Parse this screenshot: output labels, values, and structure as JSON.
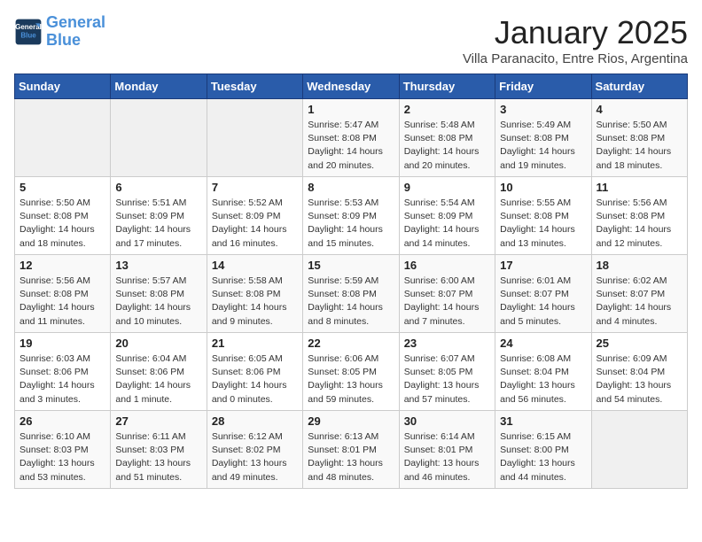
{
  "logo": {
    "line1": "General",
    "line2": "Blue"
  },
  "title": "January 2025",
  "subtitle": "Villa Paranacito, Entre Rios, Argentina",
  "days_of_week": [
    "Sunday",
    "Monday",
    "Tuesday",
    "Wednesday",
    "Thursday",
    "Friday",
    "Saturday"
  ],
  "weeks": [
    [
      {
        "day": "",
        "info": ""
      },
      {
        "day": "",
        "info": ""
      },
      {
        "day": "",
        "info": ""
      },
      {
        "day": "1",
        "info": "Sunrise: 5:47 AM\nSunset: 8:08 PM\nDaylight: 14 hours\nand 20 minutes."
      },
      {
        "day": "2",
        "info": "Sunrise: 5:48 AM\nSunset: 8:08 PM\nDaylight: 14 hours\nand 20 minutes."
      },
      {
        "day": "3",
        "info": "Sunrise: 5:49 AM\nSunset: 8:08 PM\nDaylight: 14 hours\nand 19 minutes."
      },
      {
        "day": "4",
        "info": "Sunrise: 5:50 AM\nSunset: 8:08 PM\nDaylight: 14 hours\nand 18 minutes."
      }
    ],
    [
      {
        "day": "5",
        "info": "Sunrise: 5:50 AM\nSunset: 8:08 PM\nDaylight: 14 hours\nand 18 minutes."
      },
      {
        "day": "6",
        "info": "Sunrise: 5:51 AM\nSunset: 8:09 PM\nDaylight: 14 hours\nand 17 minutes."
      },
      {
        "day": "7",
        "info": "Sunrise: 5:52 AM\nSunset: 8:09 PM\nDaylight: 14 hours\nand 16 minutes."
      },
      {
        "day": "8",
        "info": "Sunrise: 5:53 AM\nSunset: 8:09 PM\nDaylight: 14 hours\nand 15 minutes."
      },
      {
        "day": "9",
        "info": "Sunrise: 5:54 AM\nSunset: 8:09 PM\nDaylight: 14 hours\nand 14 minutes."
      },
      {
        "day": "10",
        "info": "Sunrise: 5:55 AM\nSunset: 8:08 PM\nDaylight: 14 hours\nand 13 minutes."
      },
      {
        "day": "11",
        "info": "Sunrise: 5:56 AM\nSunset: 8:08 PM\nDaylight: 14 hours\nand 12 minutes."
      }
    ],
    [
      {
        "day": "12",
        "info": "Sunrise: 5:56 AM\nSunset: 8:08 PM\nDaylight: 14 hours\nand 11 minutes."
      },
      {
        "day": "13",
        "info": "Sunrise: 5:57 AM\nSunset: 8:08 PM\nDaylight: 14 hours\nand 10 minutes."
      },
      {
        "day": "14",
        "info": "Sunrise: 5:58 AM\nSunset: 8:08 PM\nDaylight: 14 hours\nand 9 minutes."
      },
      {
        "day": "15",
        "info": "Sunrise: 5:59 AM\nSunset: 8:08 PM\nDaylight: 14 hours\nand 8 minutes."
      },
      {
        "day": "16",
        "info": "Sunrise: 6:00 AM\nSunset: 8:07 PM\nDaylight: 14 hours\nand 7 minutes."
      },
      {
        "day": "17",
        "info": "Sunrise: 6:01 AM\nSunset: 8:07 PM\nDaylight: 14 hours\nand 5 minutes."
      },
      {
        "day": "18",
        "info": "Sunrise: 6:02 AM\nSunset: 8:07 PM\nDaylight: 14 hours\nand 4 minutes."
      }
    ],
    [
      {
        "day": "19",
        "info": "Sunrise: 6:03 AM\nSunset: 8:06 PM\nDaylight: 14 hours\nand 3 minutes."
      },
      {
        "day": "20",
        "info": "Sunrise: 6:04 AM\nSunset: 8:06 PM\nDaylight: 14 hours\nand 1 minute."
      },
      {
        "day": "21",
        "info": "Sunrise: 6:05 AM\nSunset: 8:06 PM\nDaylight: 14 hours\nand 0 minutes."
      },
      {
        "day": "22",
        "info": "Sunrise: 6:06 AM\nSunset: 8:05 PM\nDaylight: 13 hours\nand 59 minutes."
      },
      {
        "day": "23",
        "info": "Sunrise: 6:07 AM\nSunset: 8:05 PM\nDaylight: 13 hours\nand 57 minutes."
      },
      {
        "day": "24",
        "info": "Sunrise: 6:08 AM\nSunset: 8:04 PM\nDaylight: 13 hours\nand 56 minutes."
      },
      {
        "day": "25",
        "info": "Sunrise: 6:09 AM\nSunset: 8:04 PM\nDaylight: 13 hours\nand 54 minutes."
      }
    ],
    [
      {
        "day": "26",
        "info": "Sunrise: 6:10 AM\nSunset: 8:03 PM\nDaylight: 13 hours\nand 53 minutes."
      },
      {
        "day": "27",
        "info": "Sunrise: 6:11 AM\nSunset: 8:03 PM\nDaylight: 13 hours\nand 51 minutes."
      },
      {
        "day": "28",
        "info": "Sunrise: 6:12 AM\nSunset: 8:02 PM\nDaylight: 13 hours\nand 49 minutes."
      },
      {
        "day": "29",
        "info": "Sunrise: 6:13 AM\nSunset: 8:01 PM\nDaylight: 13 hours\nand 48 minutes."
      },
      {
        "day": "30",
        "info": "Sunrise: 6:14 AM\nSunset: 8:01 PM\nDaylight: 13 hours\nand 46 minutes."
      },
      {
        "day": "31",
        "info": "Sunrise: 6:15 AM\nSunset: 8:00 PM\nDaylight: 13 hours\nand 44 minutes."
      },
      {
        "day": "",
        "info": ""
      }
    ]
  ]
}
